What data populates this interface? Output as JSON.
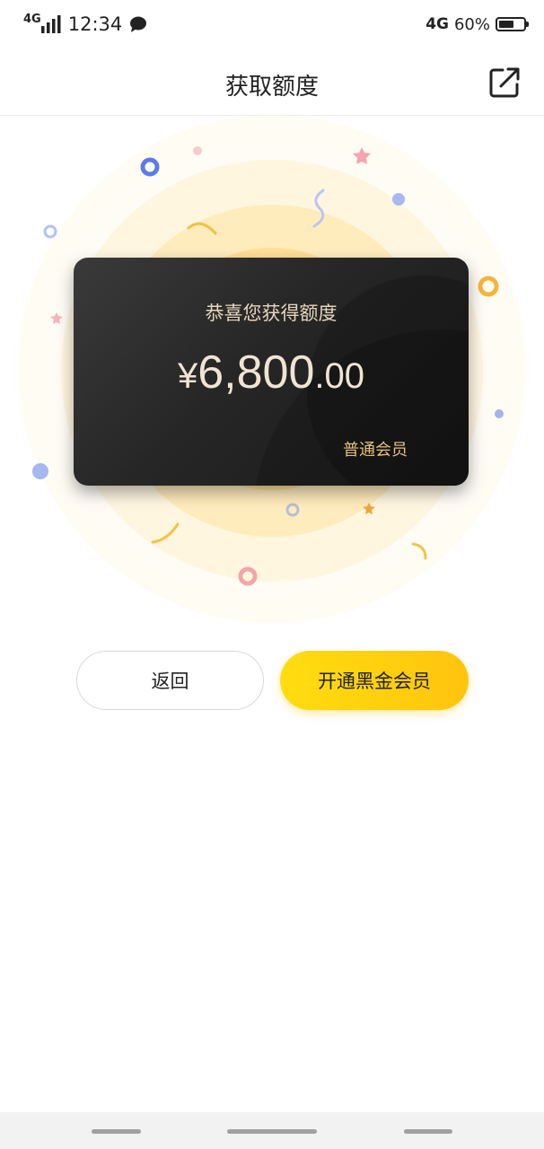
{
  "status_bar": {
    "network_left": "4G",
    "time": "12:34",
    "network_right": "4G",
    "battery_text": "60%",
    "battery_level": 0.6,
    "notification_icon": "chat-bubble-icon"
  },
  "header": {
    "title": "获取额度",
    "share_icon": "share-icon"
  },
  "card": {
    "subtitle": "恭喜您获得额度",
    "currency_symbol": "¥",
    "amount_main": "6,800",
    "amount_decimal": ".00",
    "member_level": "普通会员"
  },
  "buttons": {
    "back_label": "返回",
    "open_label": "开通黑金会员"
  },
  "colors": {
    "accent_yellow": "#ffcf0f",
    "card_dark": "#262626",
    "gold_text": "#e5c27c",
    "glow": "#ffe9b0"
  }
}
